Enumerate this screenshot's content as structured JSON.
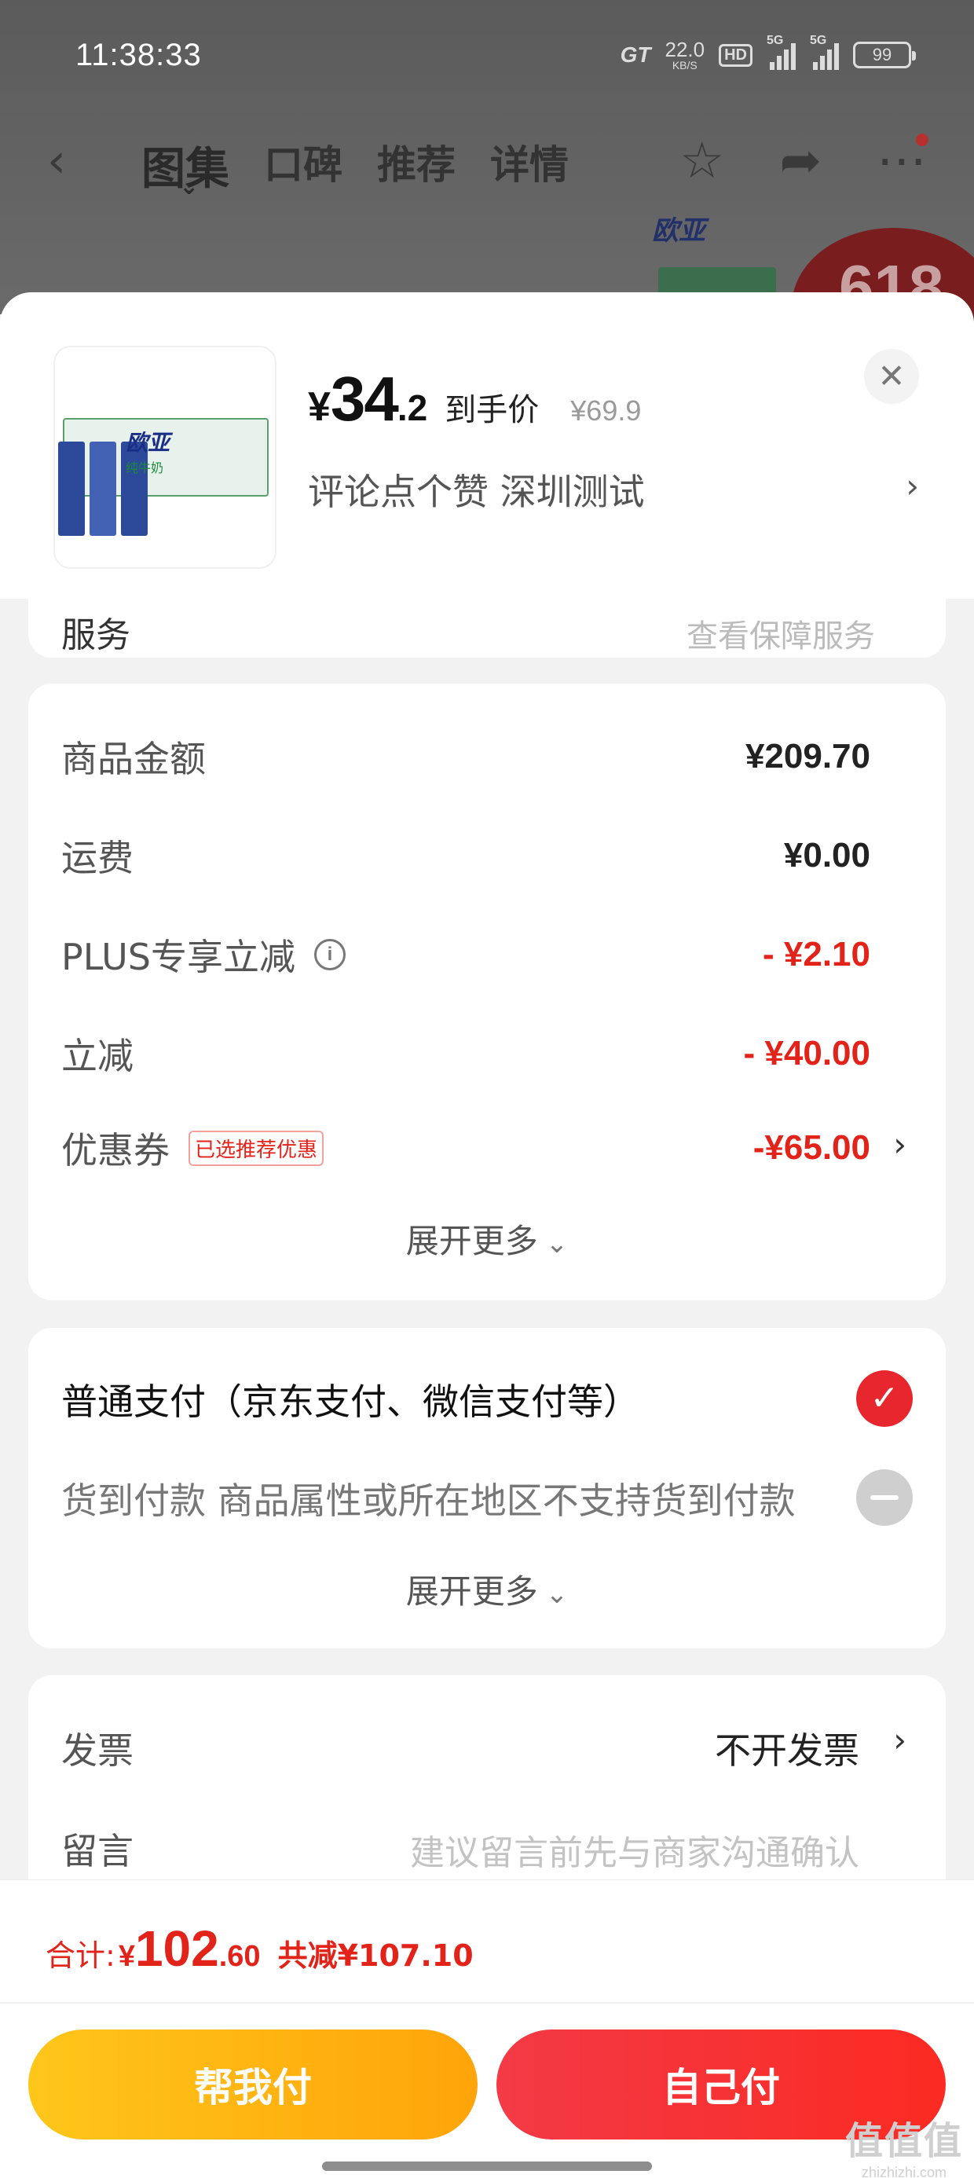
{
  "status_bar": {
    "time": "11:38:33",
    "network_brand": "GT",
    "speed_value": "22.0",
    "speed_unit": "KB/S",
    "hd_badge": "HD",
    "signal1_label": "5G",
    "signal2_label": "5G",
    "battery": "99"
  },
  "nav": {
    "back_icon": "chevron-left",
    "tabs": [
      {
        "label": "图集",
        "active": true
      },
      {
        "label": "口碑"
      },
      {
        "label": "推荐"
      },
      {
        "label": "详情"
      }
    ],
    "icons": [
      "star",
      "share",
      "more"
    ]
  },
  "background": {
    "brand_logo": "欧亚",
    "promo": "618"
  },
  "product": {
    "price_symbol": "¥",
    "price_int": "34",
    "price_dec": ".2",
    "price_tag": "到手价",
    "original_price": "¥69.9",
    "spec_text": "评论点个赞  深圳测试",
    "close_icon": "close",
    "image_brand": "欧亚",
    "image_sub": "纯牛奶"
  },
  "partial_card": {
    "label": "服务",
    "value": "查看保障服务"
  },
  "cost": {
    "rows": [
      {
        "label": "商品金额",
        "value": "¥209.70"
      },
      {
        "label": "运费",
        "value": "¥0.00"
      },
      {
        "label": "PLUS专享立减",
        "value": "- ¥2.10"
      },
      {
        "label": "立减",
        "value": "- ¥40.00"
      },
      {
        "label": "优惠券",
        "value": "-¥65.00",
        "badge": "已选推荐优惠"
      }
    ],
    "expand": "展开更多"
  },
  "payment": {
    "normal": "普通支付（京东支付、微信支付等）",
    "cod": "货到付款 商品属性或所在地区不支持货到付款",
    "expand": "展开更多"
  },
  "extras": {
    "invoice_label": "发票",
    "invoice_value": "不开发票",
    "note_label": "留言",
    "note_placeholder": "建议留言前先与商家沟通确认"
  },
  "footer": {
    "total_label": "合计:",
    "total_symbol": "¥",
    "total_int": "102",
    "total_dec": ".60",
    "discount_text": "共减¥107.10",
    "btn_helper": "帮我付",
    "btn_self": "自己付"
  },
  "watermark": {
    "line1": "值值值",
    "line2": "zhizhizhi.com"
  },
  "colors": {
    "accent_red": "#e2231a",
    "button_yellow": "#ffb30f",
    "button_red": "#f5303a"
  }
}
